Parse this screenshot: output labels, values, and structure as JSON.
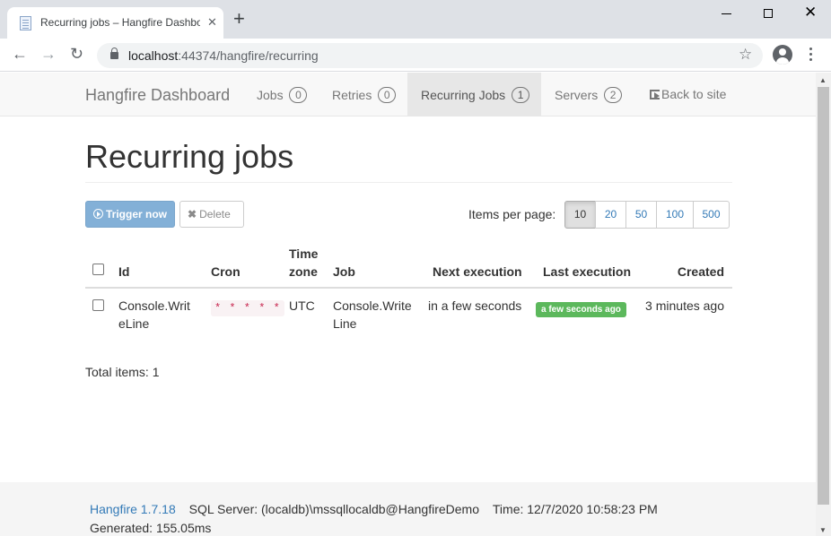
{
  "browser": {
    "tab_title": "Recurring jobs – Hangfire Dashboard",
    "url_host": "localhost",
    "url_rest": ":44374/hangfire/recurring",
    "icons": [
      "page-favicon-icon",
      "close-icon",
      "plus-icon",
      "minimize-icon",
      "maximize-icon",
      "window-close-icon",
      "back-arrow-icon",
      "forward-arrow-icon",
      "reload-icon",
      "lock-icon",
      "star-icon",
      "profile-icon",
      "kebab-menu-icon"
    ]
  },
  "navbar": {
    "brand": "Hangfire Dashboard",
    "items": [
      {
        "label": "Jobs",
        "count": "0"
      },
      {
        "label": "Retries",
        "count": "0"
      },
      {
        "label": "Recurring Jobs",
        "count": "1"
      },
      {
        "label": "Servers",
        "count": "2"
      }
    ],
    "back_label": "Back to site"
  },
  "page": {
    "title": "Recurring jobs",
    "trigger_label": "Trigger now",
    "delete_label": "Delete",
    "items_per_page_label": "Items per page:",
    "page_sizes": [
      "10",
      "20",
      "50",
      "100",
      "500"
    ],
    "selected_page_size": "10",
    "total_items": "Total items: 1"
  },
  "table": {
    "headers": {
      "id": "Id",
      "cron": "Cron",
      "timezone_line1": "Time",
      "timezone_line2": "zone",
      "job": "Job",
      "next": "Next execution",
      "last": "Last execution",
      "created": "Created"
    },
    "rows": [
      {
        "id_line1": "Console.Writ",
        "id_line2": "eLine",
        "cron": "* * * * *",
        "timezone": "UTC",
        "job_line1": "Console.Write",
        "job_line2": "Line",
        "next": "in a few seconds",
        "last": "a few seconds ago",
        "created": "3 minutes ago"
      }
    ]
  },
  "footer": {
    "version_link": "Hangfire 1.7.18",
    "server": "SQL Server: (localdb)\\mssqllocaldb@HangfireDemo",
    "time": "Time: 12/7/2020 10:58:23 PM",
    "generated": "Generated: 155.05ms"
  },
  "colors": {
    "link": "#337ab7",
    "success": "#5cb85c",
    "primary_disabled": "#83b0d7",
    "code": "#c7254e"
  }
}
